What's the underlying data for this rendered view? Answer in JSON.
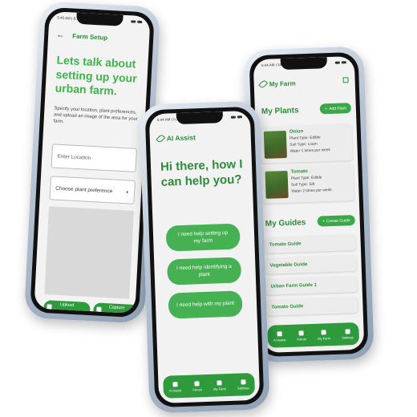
{
  "status_bar": {
    "left_time_1": "5:45 AM | 8.3KB/s",
    "left_time_2": "5:44 AM | 0.2KB/s",
    "left_time_3": "5:44 AM | 340KB/s"
  },
  "farm_setup": {
    "title": "Farm Setup",
    "heading": "Lets talk about setting up your urban farm.",
    "description": "Specify your location, plant preferences, and upload an image of the area for your farm.",
    "location_placeholder": "Enter Location",
    "plant_pref_label": "Choose plant preference",
    "upload_label": "Upload",
    "capture_label": "Capture"
  },
  "ai_assist": {
    "title": "AI Assist",
    "heading": "Hi there, how I can help you?",
    "options": [
      "I need help setting up my farm",
      "I need help identifying a plant",
      "I need help with my plant"
    ],
    "nav": [
      {
        "label": "AI Assist",
        "icon": "sparkle-icon"
      },
      {
        "label": "Forum",
        "icon": "people-icon"
      },
      {
        "label": "My Farm",
        "icon": "plant-icon"
      },
      {
        "label": "Settings",
        "icon": "gear-icon"
      }
    ]
  },
  "my_farm": {
    "title": "My Farm",
    "plants_title": "My Plants",
    "add_plant": "Add Plant",
    "plants": [
      {
        "name": "Onion",
        "type": "Plant Type: Edible",
        "soil": "Soil Type: Loam",
        "water": "Water 1 times per week"
      },
      {
        "name": "Tomato",
        "type": "Plant Type: Edible",
        "soil": "Soil Type: Silt",
        "water": "Water 2 times per week"
      }
    ],
    "guides_title": "My Guides",
    "create_guide": "Create Guide",
    "guides": [
      "Tomato Guide",
      "Vegetable Guide",
      "Urban Farm Guide 1",
      "Tomato Guide"
    ],
    "nav": [
      {
        "label": "AI Assist",
        "icon": "sparkle-icon"
      },
      {
        "label": "Forum",
        "icon": "people-icon"
      },
      {
        "label": "My Farm",
        "icon": "plant-icon"
      },
      {
        "label": "Settings",
        "icon": "gear-icon"
      }
    ]
  },
  "colors": {
    "brand_green": "#2f9a3c",
    "heading_green": "#3cb64a",
    "text_green": "#2e8b3a"
  }
}
